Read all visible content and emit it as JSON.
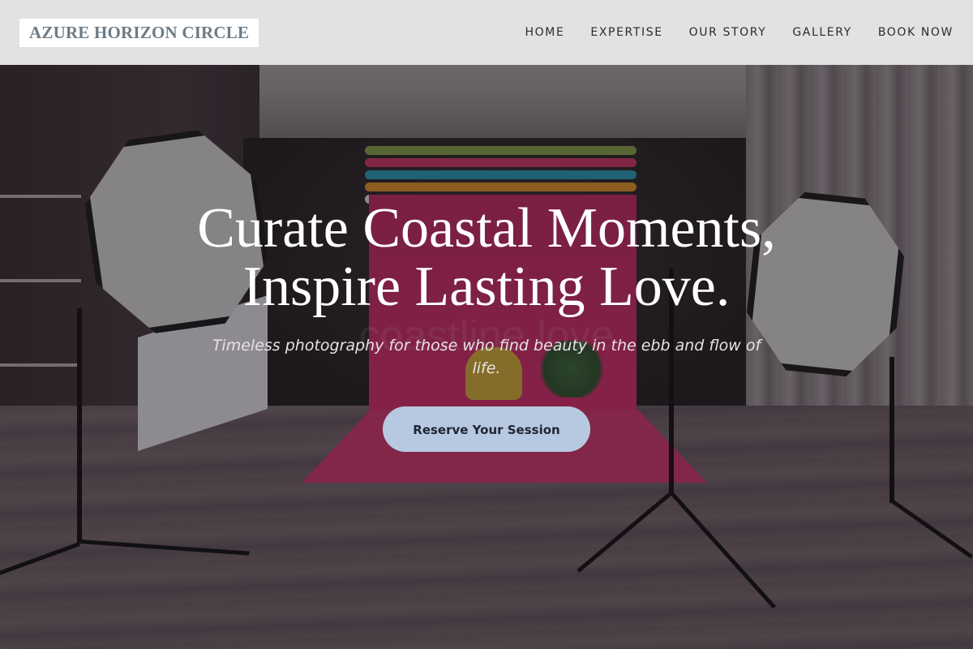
{
  "brand": {
    "logo_text": "AZURE HORIZON CIRCLE"
  },
  "nav": {
    "items": [
      {
        "label": "HOME"
      },
      {
        "label": "EXPERTISE"
      },
      {
        "label": "OUR STORY"
      },
      {
        "label": "GALLERY"
      },
      {
        "label": "BOOK NOW"
      }
    ]
  },
  "hero": {
    "headline_line1": "Curate Coastal Moments,",
    "headline_line2": "Inspire Lasting Love.",
    "subtitle": "Timeless photography for those who find beauty in the ebb and flow of life.",
    "cta_label": "Reserve Your Session",
    "background_sign_text": "coastline love"
  },
  "colors": {
    "nav_background": "#eceaec",
    "logo_text": "#6c7b86",
    "cta_background": "#b7c9e0",
    "cta_text": "#1f2533",
    "backdrop_accent": "#d8306f"
  }
}
